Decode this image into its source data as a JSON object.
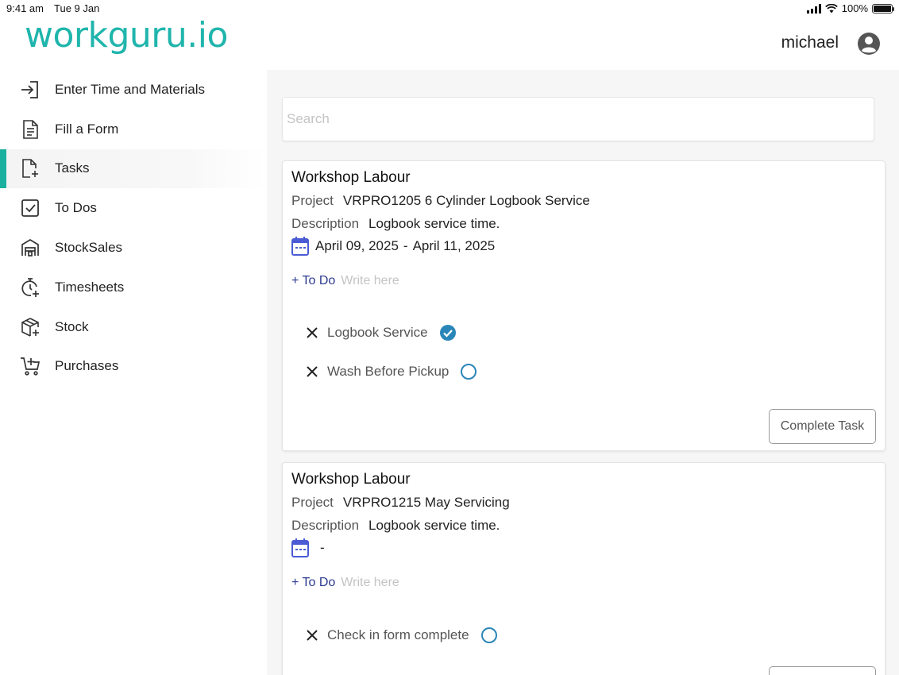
{
  "status_bar": {
    "time": "9:41 am",
    "date": "Tue 9 Jan",
    "battery": "100%",
    "battery_level": 1.0
  },
  "header": {
    "logo": "workguru.io",
    "user_name": "michael"
  },
  "colors": {
    "brand": "#1fb5ac",
    "active_indicator": "#1ab1a0",
    "todo_link": "#2b3a8f",
    "check_done": "#2a86b8",
    "calendar": "#4a5bd4"
  },
  "sidebar": {
    "items": [
      {
        "label": "Enter Time and Materials",
        "icon": "enter-icon",
        "active": false
      },
      {
        "label": "Fill a Form",
        "icon": "form-icon",
        "active": false
      },
      {
        "label": "Tasks",
        "icon": "tasks-icon",
        "active": true
      },
      {
        "label": "To Dos",
        "icon": "checkbox-icon",
        "active": false
      },
      {
        "label": "StockSales",
        "icon": "warehouse-icon",
        "active": false
      },
      {
        "label": "Timesheets",
        "icon": "stopwatch-icon",
        "active": false
      },
      {
        "label": "Stock",
        "icon": "box-icon",
        "active": false
      },
      {
        "label": "Purchases",
        "icon": "cart-icon",
        "active": false
      }
    ]
  },
  "search": {
    "placeholder": "Search",
    "value": ""
  },
  "tasks": [
    {
      "title": "Workshop Labour",
      "project_label": "Project",
      "project_value": "VRPRO1205  6 Cylinder Logbook Service",
      "description_label": "Description",
      "description_value": "Logbook service time.",
      "date_start": "April 09, 2025",
      "date_sep": "-",
      "date_end": "April 11, 2025",
      "todo_add_label": "+ To Do",
      "todo_placeholder": "Write here",
      "todos": [
        {
          "text": "Logbook Service",
          "done": true
        },
        {
          "text": "Wash Before Pickup",
          "done": false
        }
      ],
      "complete_label": "Complete Task"
    },
    {
      "title": "Workshop Labour",
      "project_label": "Project",
      "project_value": "VRPRO1215  May Servicing",
      "description_label": "Description",
      "description_value": "Logbook service time.",
      "date_start": "",
      "date_sep": "-",
      "date_end": "",
      "todo_add_label": "+ To Do",
      "todo_placeholder": "Write here",
      "todos": [
        {
          "text": "Check in form complete",
          "done": false
        }
      ]
    }
  ]
}
